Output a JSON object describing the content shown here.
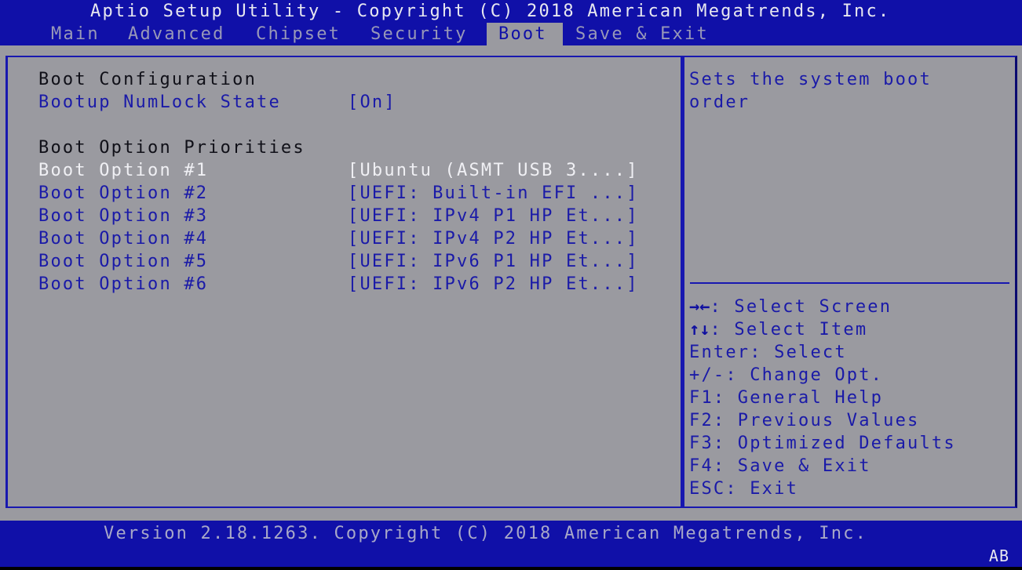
{
  "header": {
    "title": "Aptio Setup Utility - Copyright (C) 2018 American Megatrends, Inc.",
    "tabs": [
      {
        "label": "Main",
        "active": false
      },
      {
        "label": "Advanced",
        "active": false
      },
      {
        "label": "Chipset",
        "active": false
      },
      {
        "label": "Security",
        "active": false
      },
      {
        "label": "Boot",
        "active": true
      },
      {
        "label": "Save & Exit",
        "active": false
      }
    ]
  },
  "main": {
    "sections": {
      "boot_configuration": "Boot Configuration",
      "boot_option_priorities": "Boot Option Priorities"
    },
    "numlock": {
      "label": "Bootup NumLock State",
      "value": "[On]"
    },
    "boot_options": [
      {
        "label": "Boot Option #1",
        "value": "[Ubuntu (ASMT USB 3....]",
        "selected": true
      },
      {
        "label": "Boot Option #2",
        "value": "[UEFI: Built-in EFI ...]",
        "selected": false
      },
      {
        "label": "Boot Option #3",
        "value": "[UEFI: IPv4 P1 HP Et...]",
        "selected": false
      },
      {
        "label": "Boot Option #4",
        "value": "[UEFI: IPv4 P2 HP Et...]",
        "selected": false
      },
      {
        "label": "Boot Option #5",
        "value": "[UEFI: IPv6 P1 HP Et...]",
        "selected": false
      },
      {
        "label": "Boot Option #6",
        "value": "[UEFI: IPv6 P2 HP Et...]",
        "selected": false
      }
    ]
  },
  "help": {
    "description_lines": [
      "Sets the system boot",
      "order"
    ],
    "keys": [
      {
        "key": "→←",
        "sep": ": ",
        "action": "Select Screen",
        "icon": "left-right-arrows-icon"
      },
      {
        "key": "↑↓",
        "sep": ": ",
        "action": "Select Item",
        "icon": "up-down-arrows-icon"
      },
      {
        "key": "Enter",
        "sep": ": ",
        "action": "Select"
      },
      {
        "key": "+/-",
        "sep": ": ",
        "action": "Change Opt."
      },
      {
        "key": "F1",
        "sep": ": ",
        "action": "General Help"
      },
      {
        "key": "F2",
        "sep": ": ",
        "action": "Previous Values"
      },
      {
        "key": "F3",
        "sep": ": ",
        "action": "Optimized Defaults"
      },
      {
        "key": "F4",
        "sep": ": ",
        "action": "Save & Exit"
      },
      {
        "key": "ESC",
        "sep": ": ",
        "action": "Exit"
      }
    ]
  },
  "footer": {
    "version_text": "Version 2.18.1263. Copyright (C) 2018 American Megatrends, Inc.",
    "badge": "AB"
  },
  "colors": {
    "header_blue": "#1010a8",
    "panel_gray": "#9a9aa0",
    "item_blue": "#1a1aa8",
    "selected_white": "#f0f0f4",
    "section_black": "#101018"
  }
}
